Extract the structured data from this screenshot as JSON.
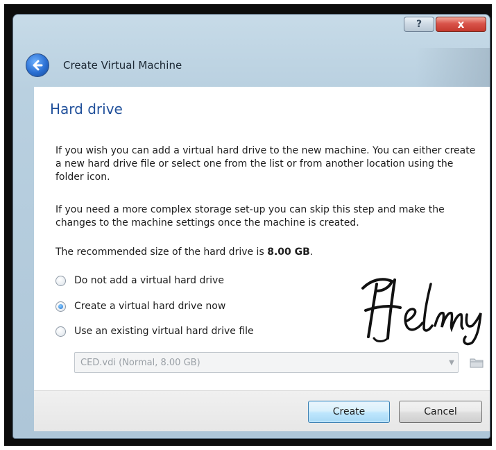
{
  "window": {
    "title": "Create Virtual Machine",
    "help_label": "?",
    "close_label": "x"
  },
  "page": {
    "title": "Hard drive",
    "paragraph1": "If you wish you can add a virtual hard drive to the new machine. You can either create a new hard drive file or select one from the list or from another location using the folder icon.",
    "paragraph2": "If you need a more complex storage set-up you can skip this step and make the changes to the machine settings once the machine is created.",
    "recommended_prefix": "The recommended size of the hard drive is ",
    "recommended_size": "8.00 GB",
    "recommended_suffix": "."
  },
  "options": [
    {
      "label": "Do not add a virtual hard drive",
      "checked": false
    },
    {
      "label": "Create a virtual hard drive now",
      "checked": true
    },
    {
      "label": "Use an existing virtual hard drive file",
      "checked": false
    }
  ],
  "existing_file": {
    "selected": "CED.vdi (Normal, 8.00 GB)",
    "enabled": false
  },
  "watermark": {
    "text": "Helmy"
  },
  "buttons": {
    "create": "Create",
    "cancel": "Cancel"
  },
  "icons": {
    "back": "back-arrow-icon",
    "folder": "folder-icon",
    "dropdown": "chevron-down-icon"
  },
  "colors": {
    "title_blue": "#1f4f9a",
    "close_red": "#c4392e",
    "back_blue": "#2a6fd2"
  }
}
